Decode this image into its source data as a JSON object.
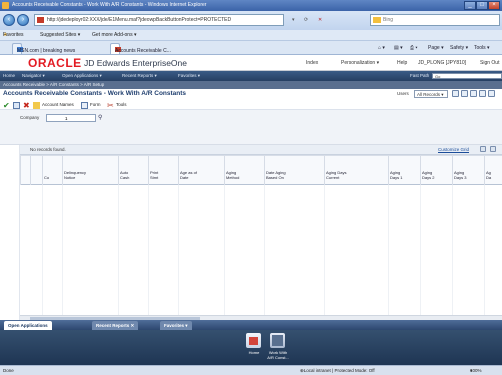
{
  "window": {
    "title": "Accounts Receivable Constants - Work With A/R Constants - Windows Internet Explorer"
  },
  "browser": {
    "address": "http://jdedeployr02:XXX/jde/E1Menu.maf?jdeowpBackButtonProtect=PROTECTED",
    "search_placeholder": "Bing",
    "favorites_label": "Favorites",
    "fav_links": [
      "Suggested Sites ▾",
      "Get more Add-ons ▾"
    ],
    "tabs": [
      "MSN.com | breaking news",
      "Accounts Receivable C..."
    ],
    "commands": [
      "Page ▾",
      "Safety ▾",
      "Tools ▾"
    ]
  },
  "oracle": {
    "logo": "ORACLE",
    "product": "JD Edwards EnterpriseOne",
    "links": [
      "Index",
      "Personalization ▾",
      "Help",
      "JD_PLONG [JPY810]",
      "Sign Out"
    ]
  },
  "menubar": {
    "items": [
      "Home",
      "Navigator ▾",
      "Open Applications ▾",
      "Recent Reports ▾",
      "Favorites ▾"
    ],
    "fastpath_label": "Fast Path",
    "fastpath_value": "Go"
  },
  "breadcrumb": "Accounts Receivable > A/R Constants > A/R Setup",
  "form": {
    "title": "Accounts Receivable Constants - Work With A/R Constants",
    "users_label": "Users",
    "users_value": "All Records"
  },
  "toolbar": {
    "buttons": [
      "Account Names",
      "Form",
      "Tools"
    ]
  },
  "filter": {
    "company_label": "Company",
    "company_value": "1"
  },
  "grid": {
    "records_label": "No records found.",
    "customize_label": "Customize Grid",
    "columns": [
      {
        "label": "Co"
      },
      {
        "label": "Delinquency\nNotice"
      },
      {
        "label": "Auto\nCash"
      },
      {
        "label": "Print\nStmt"
      },
      {
        "label": "Age as of\nDate"
      },
      {
        "label": "Aging\nMethod"
      },
      {
        "label": "Date Aging\nBased On"
      },
      {
        "label": "Aging Days\nCurrent"
      },
      {
        "label": "Aging\nDays 1"
      },
      {
        "label": "Aging\nDays 2"
      },
      {
        "label": "Aging\nDays 3"
      },
      {
        "label": "Ag\nDa"
      }
    ]
  },
  "bottom_tabs": [
    "Open Applications",
    "Recent Reports",
    "Favorites"
  ],
  "launch": {
    "items": [
      "Home",
      "Work With\nA/R Const..."
    ]
  },
  "status": {
    "left": "Done",
    "zone": "Local intranet | Protected Mode: Off",
    "zoom": "100%"
  }
}
